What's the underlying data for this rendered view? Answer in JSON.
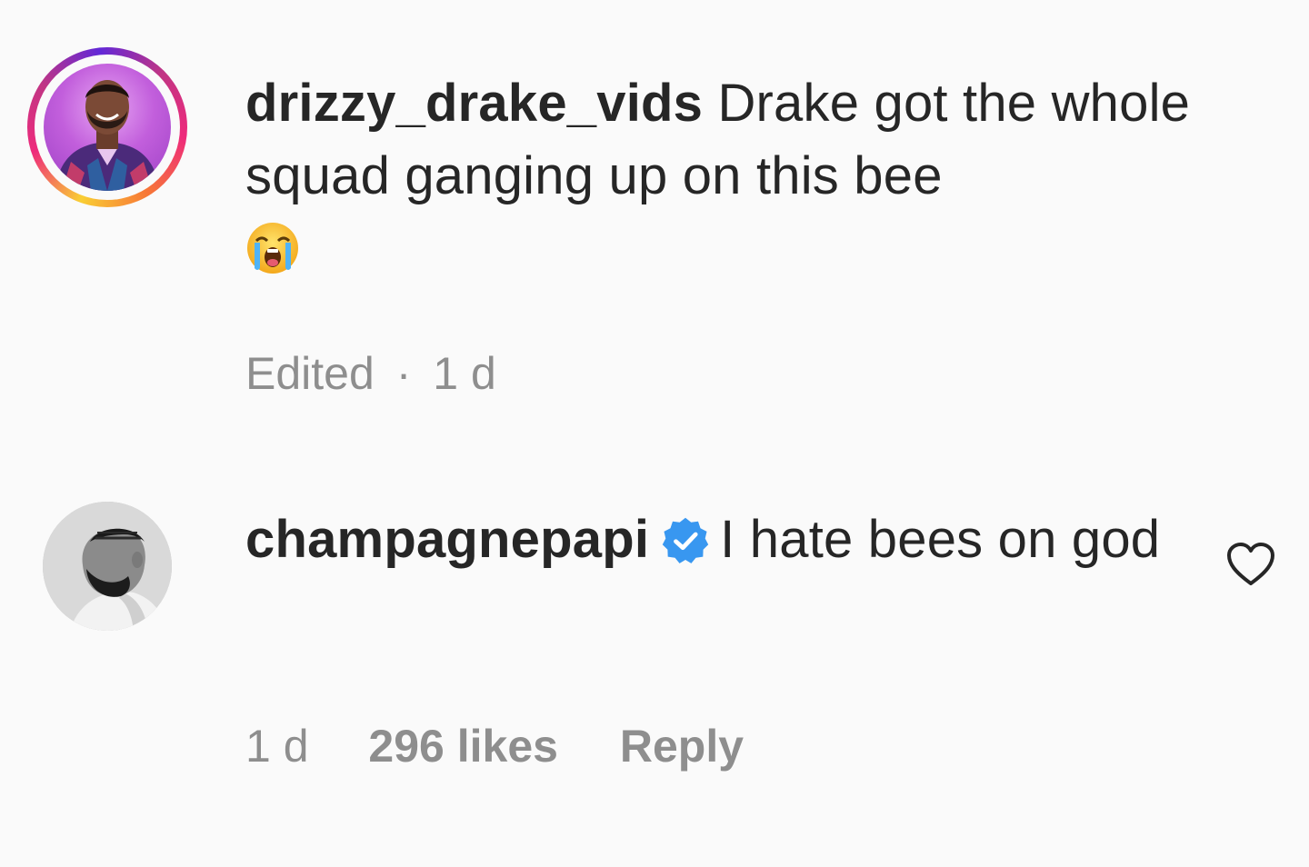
{
  "comments": [
    {
      "username": "drizzy_drake_vids",
      "text": "Drake got the whole squad ganging up on this bee",
      "emoji": "😭",
      "emoji_icon": "loudly-crying-face-icon",
      "verified": false,
      "has_story_ring": true,
      "meta": {
        "edited": "Edited",
        "separator": "·",
        "time": "1 d"
      }
    },
    {
      "username": "champagnepapi",
      "text": "I hate bees on god",
      "verified": true,
      "verified_icon": "verified-badge-icon",
      "like_icon": "heart-outline-icon",
      "meta": {
        "time": "1 d",
        "likes": "296 likes",
        "reply": "Reply"
      }
    }
  ],
  "colors": {
    "background": "#fafafa",
    "text": "#262626",
    "secondary_text": "#8e8e8e",
    "verified_blue": "#3897f0"
  }
}
